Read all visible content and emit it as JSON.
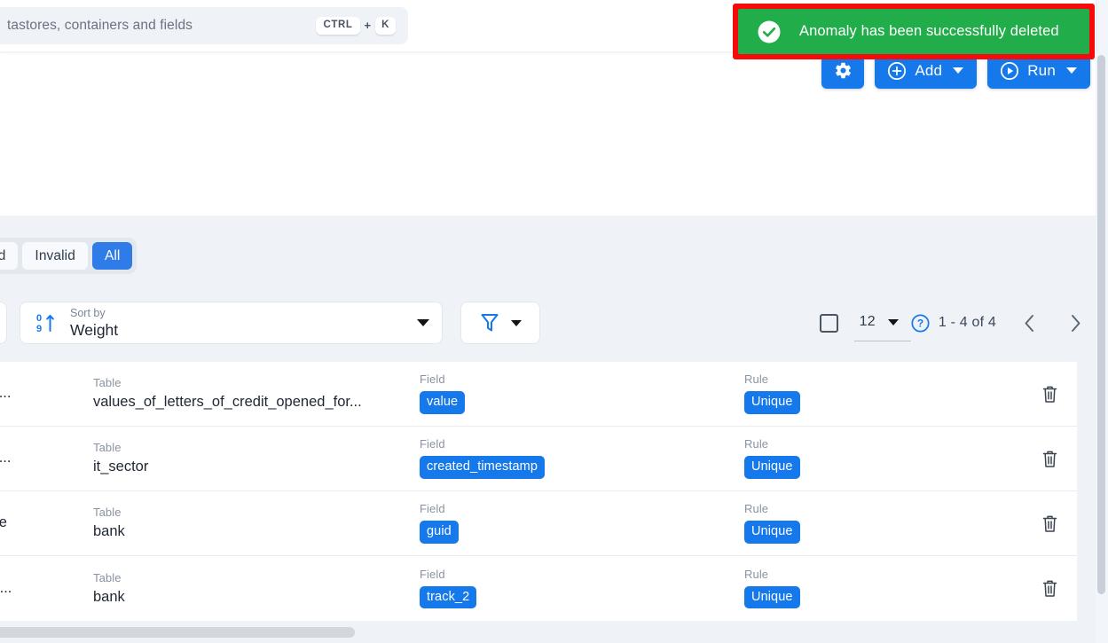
{
  "search": {
    "placeholder": "tastores, containers and fields",
    "shortcut_key1": "CTRL",
    "shortcut_plus": "+",
    "shortcut_key2": "K"
  },
  "toast": {
    "message": "Anomaly has been successfully deleted",
    "icon": "check-circle-icon",
    "background": "#22ad4b",
    "outline": "#f60b0b"
  },
  "actions": {
    "settings_icon": "gear-icon",
    "add_label": "Add",
    "add_icon": "plus-circle-icon",
    "run_label": "Run",
    "run_icon": "play-circle-icon",
    "accent": "#1579eb"
  },
  "filters": {
    "tabs": [
      {
        "label": "Resolved",
        "active": false
      },
      {
        "label": "Invalid",
        "active": false
      },
      {
        "label": "All",
        "active": true
      }
    ]
  },
  "sort": {
    "label": "Sort by",
    "value": "Weight",
    "icon": "sort-numeric-asc-icon",
    "filter_icon": "funnel-icon"
  },
  "pagination": {
    "checkbox_checked": false,
    "page_size": "12",
    "help_icon": "help-circle-icon",
    "range": "1 - 4 of 4",
    "prev_icon": "chevron-left-icon",
    "next_icon": "chevron-right-icon"
  },
  "table": {
    "headers": {
      "table": "Table",
      "field": "Field",
      "rule": "Rule"
    },
    "rows": [
      {
        "name": "not uniq...",
        "table": "values_of_letters_of_credit_opened_for...",
        "field": "value",
        "rule": "Unique",
        "delete_icon": "trash-icon"
      },
      {
        "name": "red valu...",
        "table": "it_sector",
        "field": "created_timestamp",
        "rule": "Unique",
        "delete_icon": "trash-icon"
      },
      {
        "name": "ot unique",
        "table": "bank",
        "field": "guid",
        "rule": "Unique",
        "delete_icon": "trash-icon"
      },
      {
        "name": "e not un...",
        "table": "bank",
        "field": "track_2",
        "rule": "Unique",
        "delete_icon": "trash-icon"
      }
    ]
  }
}
